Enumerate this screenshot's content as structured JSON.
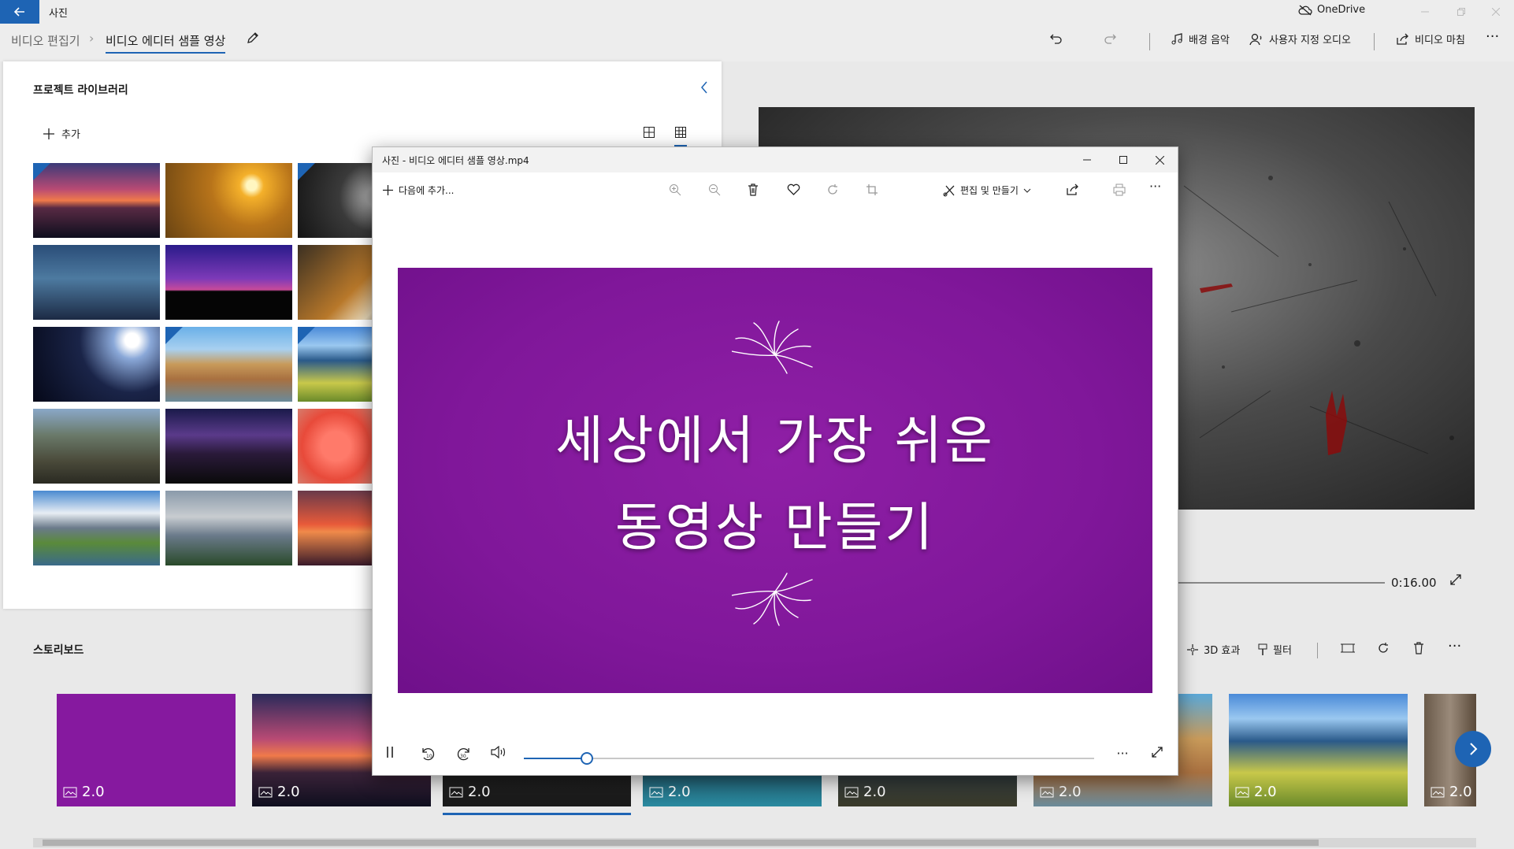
{
  "app": {
    "title": "사진",
    "onedrive": "OneDrive"
  },
  "breadcrumb": {
    "root": "비디오 편집기",
    "current": "비디오 에디터 샘플 영상"
  },
  "toolbar": {
    "background_music": "배경 음악",
    "custom_audio": "사용자 지정 오디오",
    "finish_video": "비디오 마침"
  },
  "library": {
    "title": "프로젝트 라이브러리",
    "add_label": "추가",
    "thumbnails": [
      {
        "name": "sunset-lake",
        "badge": true
      },
      {
        "name": "golden-field",
        "badge": false
      },
      {
        "name": "dark-skull",
        "badge": true
      },
      {
        "name": "lanterns-night",
        "badge": false
      },
      {
        "name": "purple-building",
        "badge": false
      },
      {
        "name": "tiger",
        "badge": false
      },
      {
        "name": "planet-space",
        "badge": false
      },
      {
        "name": "florence-bridge",
        "badge": true
      },
      {
        "name": "coast-flowers",
        "badge": true
      },
      {
        "name": "yosemite-valley",
        "badge": false
      },
      {
        "name": "milky-way-road",
        "badge": false
      },
      {
        "name": "red-flowers",
        "badge": false
      },
      {
        "name": "mountain-stream",
        "badge": false
      },
      {
        "name": "steam-train",
        "badge": false
      },
      {
        "name": "red-sunset-sea",
        "badge": false
      }
    ]
  },
  "preview": {
    "time": "0:16.00"
  },
  "storyboard": {
    "title": "스토리보드",
    "effects_3d": "3D 효과",
    "filters": "필터",
    "tiles": [
      {
        "duration": "2.0"
      },
      {
        "duration": "2.0"
      },
      {
        "duration": "2.0"
      },
      {
        "duration": "2.0"
      },
      {
        "duration": "2.0"
      },
      {
        "duration": "2.0"
      },
      {
        "duration": "2.0"
      },
      {
        "duration": "2.0"
      }
    ],
    "selected_index": 2
  },
  "photos_window": {
    "title": "사진 - 비디오 에디터 샘플 영상.mp4",
    "add_to": "다음에 추가...",
    "edit_create": "편집 및 만들기",
    "slide_line1": "세상에서 가장 쉬운",
    "slide_line2": "동영상 만들기",
    "playback_progress": 0.11
  },
  "colors": {
    "accent": "#1e64b4",
    "slide_purple": "#86199f"
  }
}
